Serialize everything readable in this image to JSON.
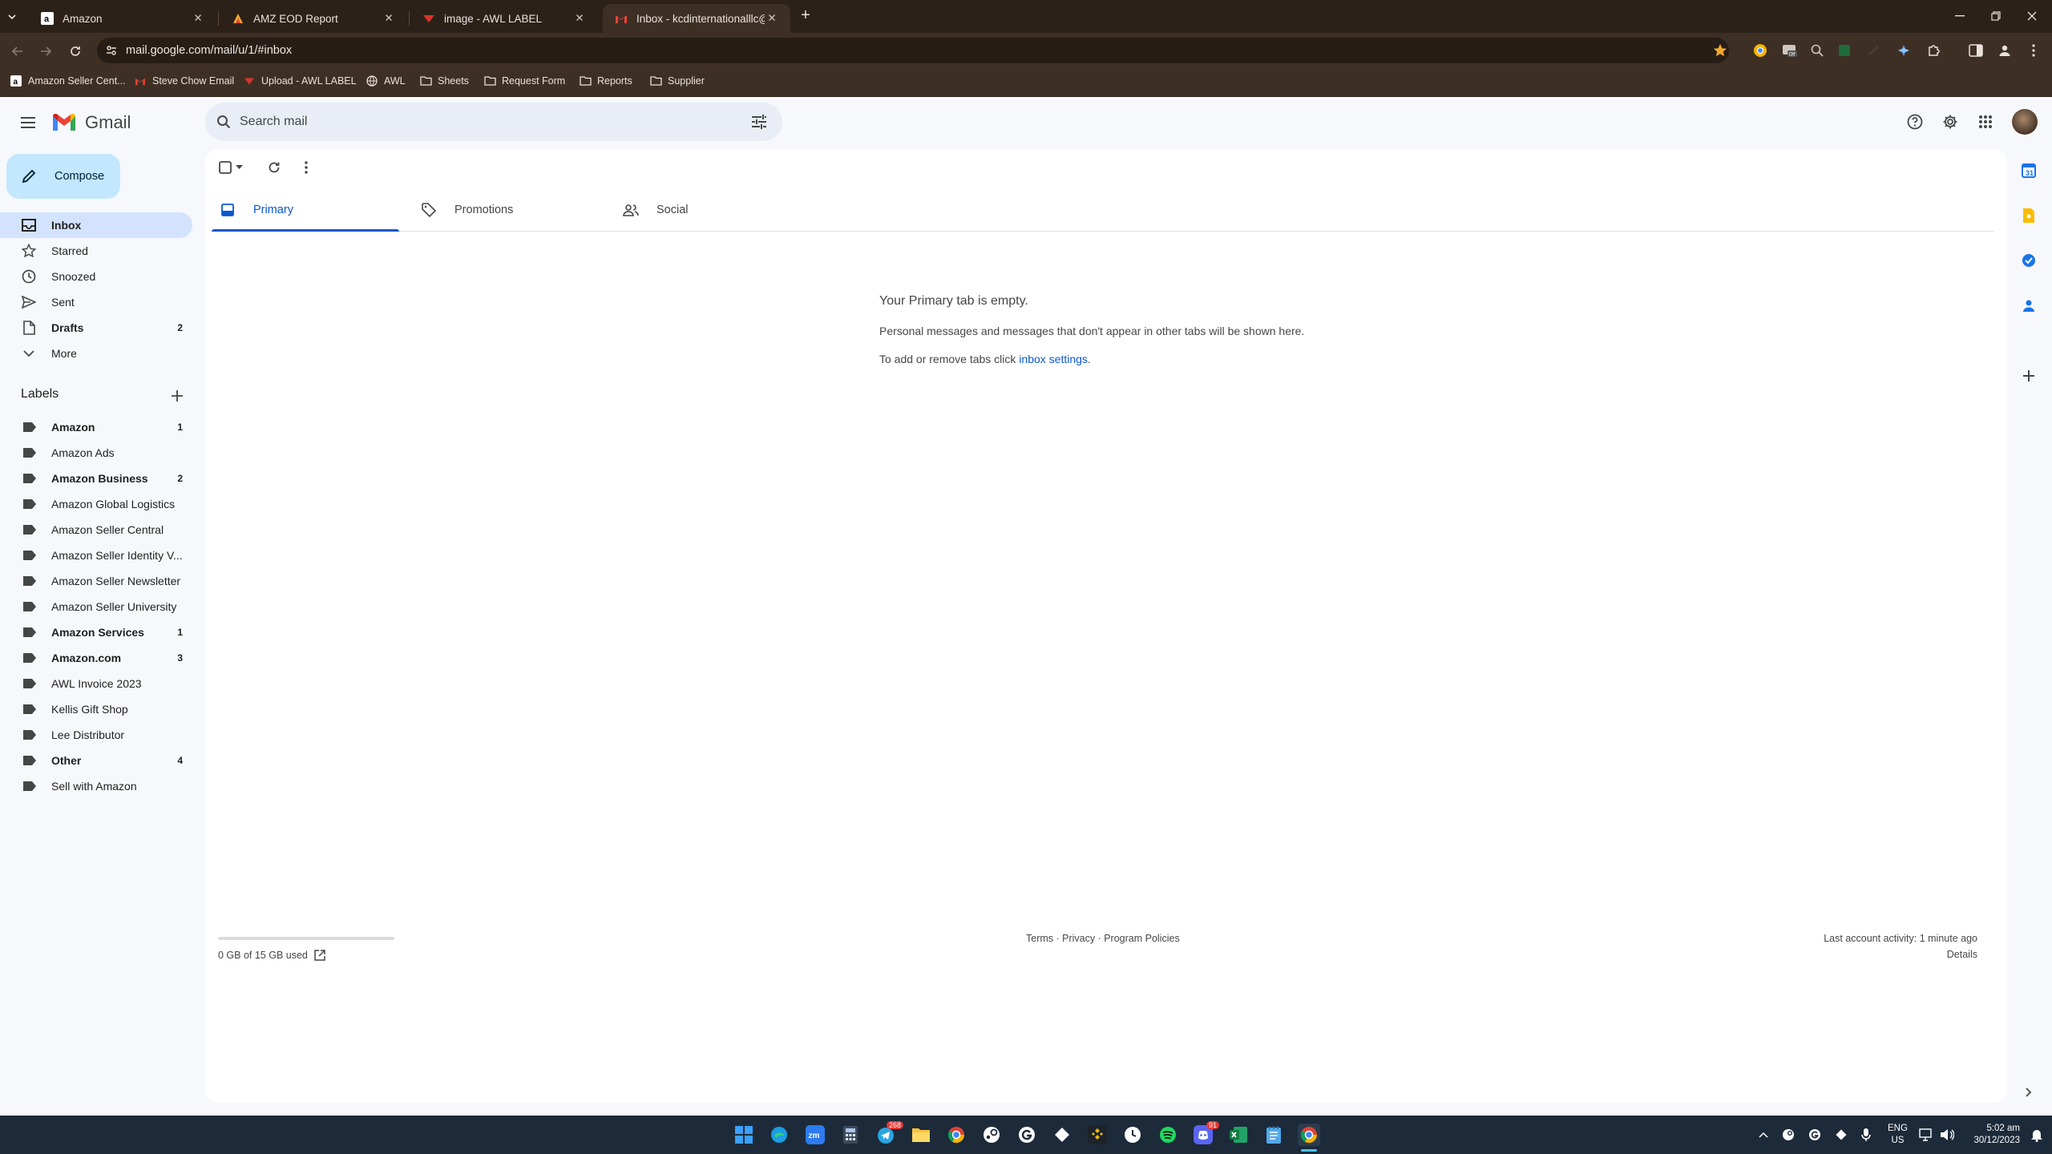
{
  "browser": {
    "tabs": [
      {
        "label": "Amazon",
        "active": false
      },
      {
        "label": "AMZ EOD Report",
        "active": false
      },
      {
        "label": "image - AWL LABEL",
        "active": false
      },
      {
        "label": "Inbox - kcdinternationalllc@gm",
        "active": true
      }
    ],
    "url": "mail.google.com/mail/u/1/#inbox",
    "bookmarks": [
      "Amazon Seller Cent...",
      "Steve Chow Email",
      "Upload - AWL LABEL",
      "AWL",
      "Sheets",
      "Request Form",
      "Reports",
      "Supplier"
    ]
  },
  "gmail": {
    "brand": "Gmail",
    "search_placeholder": "Search mail",
    "compose_label": "Compose",
    "nav": [
      {
        "label": "Inbox",
        "count": "",
        "icon": "inbox-icon"
      },
      {
        "label": "Starred",
        "count": "",
        "icon": "star-icon"
      },
      {
        "label": "Snoozed",
        "count": "",
        "icon": "clock-icon"
      },
      {
        "label": "Sent",
        "count": "",
        "icon": "send-icon"
      },
      {
        "label": "Drafts",
        "count": "2",
        "icon": "draft-icon"
      },
      {
        "label": "More",
        "count": "",
        "icon": "chevron-down-icon"
      }
    ],
    "labels_heading": "Labels",
    "labels": [
      {
        "label": "Amazon",
        "count": "1",
        "bold": true
      },
      {
        "label": "Amazon Ads",
        "count": "",
        "bold": false
      },
      {
        "label": "Amazon Business",
        "count": "2",
        "bold": true
      },
      {
        "label": "Amazon Global Logistics",
        "count": "",
        "bold": false
      },
      {
        "label": "Amazon Seller Central",
        "count": "",
        "bold": false
      },
      {
        "label": "Amazon Seller Identity V...",
        "count": "",
        "bold": false
      },
      {
        "label": "Amazon Seller Newsletter",
        "count": "",
        "bold": false
      },
      {
        "label": "Amazon Seller University",
        "count": "",
        "bold": false
      },
      {
        "label": "Amazon Services",
        "count": "1",
        "bold": true
      },
      {
        "label": "Amazon.com",
        "count": "3",
        "bold": true
      },
      {
        "label": "AWL Invoice 2023",
        "count": "",
        "bold": false
      },
      {
        "label": "Kellis Gift Shop",
        "count": "",
        "bold": false
      },
      {
        "label": "Lee Distributor",
        "count": "",
        "bold": false
      },
      {
        "label": "Other",
        "count": "4",
        "bold": true
      },
      {
        "label": "Sell with Amazon",
        "count": "",
        "bold": false
      }
    ],
    "tabs": [
      {
        "label": "Primary",
        "active": true
      },
      {
        "label": "Promotions",
        "active": false
      },
      {
        "label": "Social",
        "active": false
      }
    ],
    "empty": {
      "title": "Your Primary tab is empty.",
      "line1": "Personal messages and messages that don't appear in other tabs will be shown here.",
      "line2_prefix": "To add or remove tabs click ",
      "line2_link": "inbox settings",
      "line2_suffix": "."
    },
    "footer": {
      "storage": "0 GB of 15 GB used",
      "storage_used_fraction": 0.0,
      "policies": "Terms · Privacy · Program Policies",
      "activity": "Last account activity: 1 minute ago",
      "details": "Details"
    }
  },
  "taskbar": {
    "lang_line1": "ENG",
    "lang_line2": "US",
    "time": "5:02 am",
    "date": "30/12/2023",
    "telegram_badge": "268",
    "discord_badge": "91"
  },
  "colors": {
    "accent": "#0b57d0",
    "compose_bg": "#c2e7ff",
    "nav_active": "#d3e3fd",
    "chrome_dark": "#2c2118",
    "chrome_toolbar": "#3e2f24"
  }
}
